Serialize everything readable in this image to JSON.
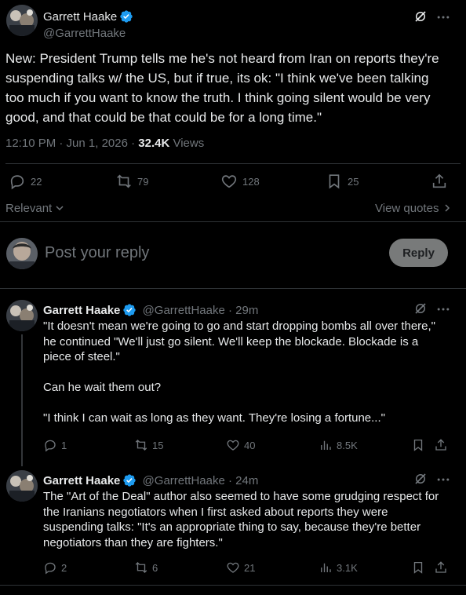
{
  "main_post": {
    "author_name": "Garrett Haake",
    "author_handle": "@GarrettHaake",
    "text": "New: President Trump tells me he's not heard from Iran on reports they're\nsuspending talks w/ the US, but if true, its ok: \"I think we've been talking\ntoo much if you want to know the truth. I think going silent would be very\ngood, and that could be that could be for a long time.\"",
    "time": "12:10 PM · Jun 1, 2026 · ",
    "views_count": "32.4K",
    "views_label": " Views",
    "replies": "22",
    "reposts": "79",
    "likes": "128",
    "bookmarks": "25"
  },
  "sort": {
    "label": "Relevant",
    "view_quotes": "View quotes"
  },
  "composer": {
    "placeholder": "Post your reply",
    "button": "Reply"
  },
  "replies": [
    {
      "name": "Garrett Haake",
      "handle_time": "@GarrettHaake · 29m",
      "text": "\"It doesn't mean we're going to go and start dropping bombs all over there,\"\nhe continued \"We'll just go silent. We'll keep the blockade. Blockade is a\npiece of steel.\"\n\nCan he wait them out?\n\n\"I think I can wait as long as they want. They're losing a fortune...\"",
      "replies": "1",
      "reposts": "15",
      "likes": "40",
      "views": "8.5K"
    },
    {
      "name": "Garrett Haake",
      "handle_time": "@GarrettHaake · 24m",
      "text": "The \"Art of the Deal\" author also seemed to have some grudging respect for\nthe Iranians negotiators when I first asked about reports they were\nsuspending talks: \"It's an appropriate thing to say, because they're better\nnegotiators than they are fighters.\"",
      "replies": "2",
      "reposts": "6",
      "likes": "21",
      "views": "3.1K"
    }
  ],
  "colors": {
    "background": "#000000",
    "text": "#e7e9ea",
    "muted": "#71767b",
    "verified": "#1d9bf0",
    "divider": "#2f3336"
  }
}
